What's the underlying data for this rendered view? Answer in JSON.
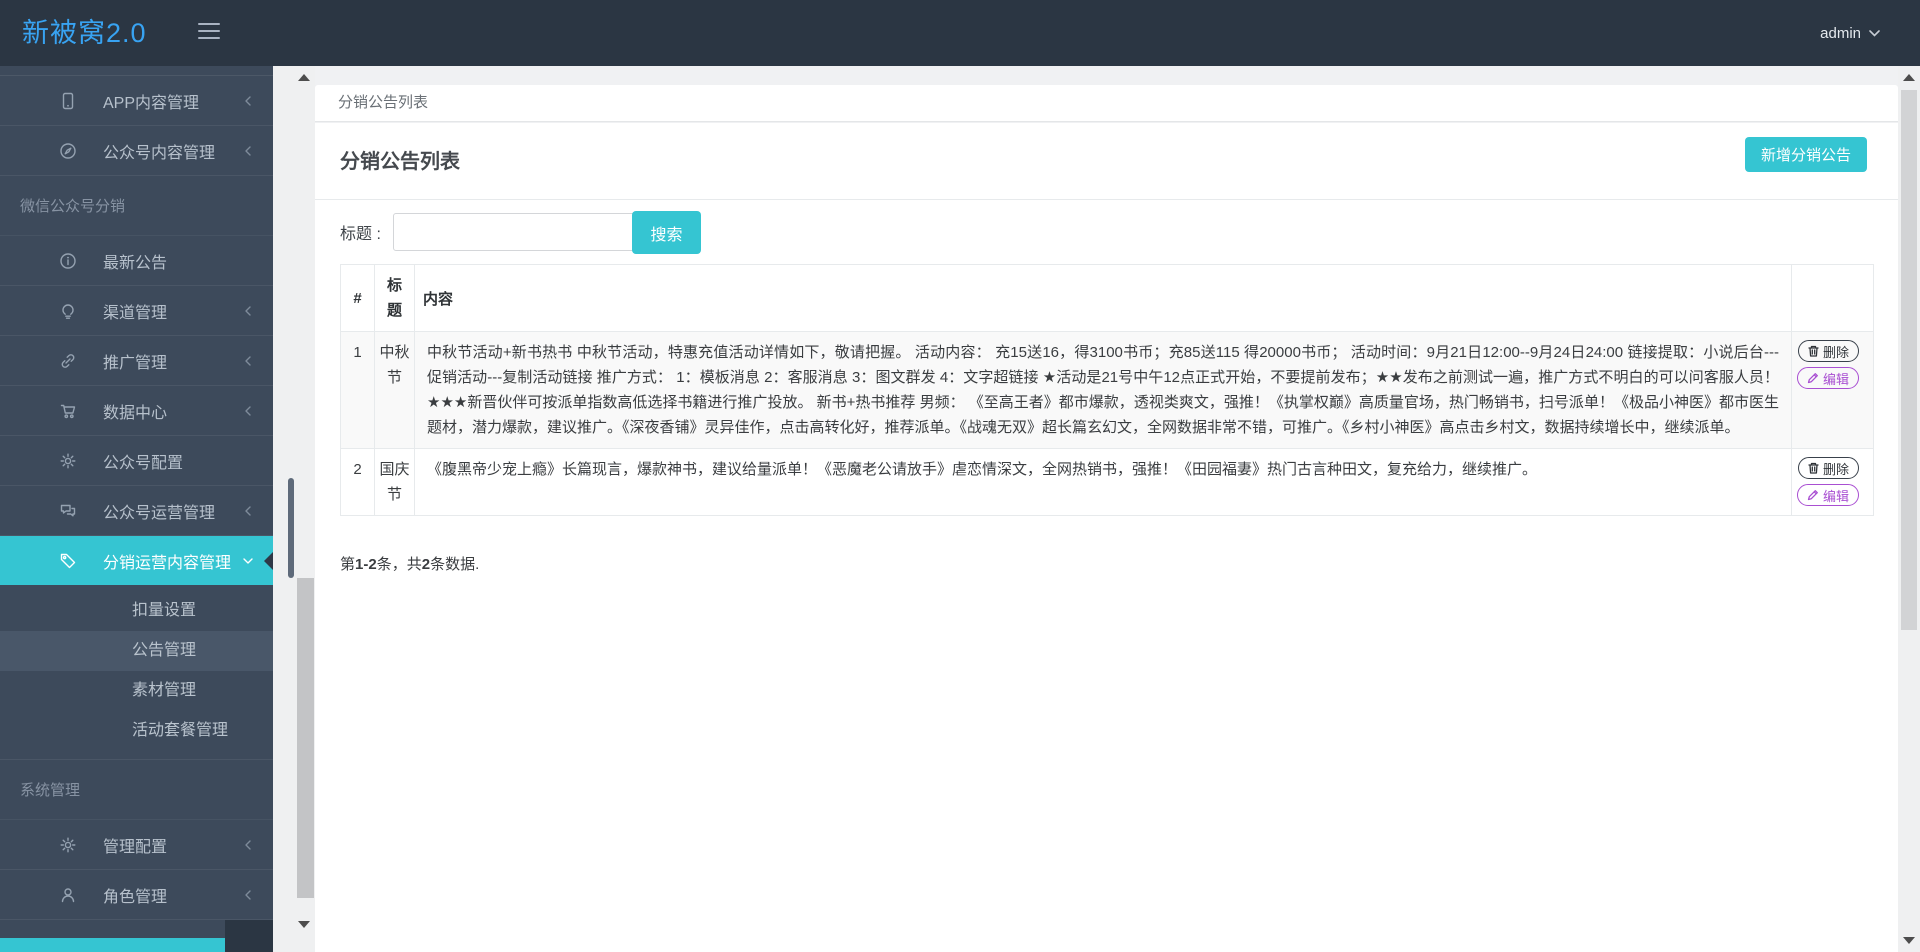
{
  "header": {
    "logo": "新被窝2.0",
    "user": "admin"
  },
  "sidebar": {
    "top_items": [
      {
        "label": "APP内容管理",
        "icon": "mobile-icon"
      },
      {
        "label": "公众号内容管理",
        "icon": "compass-icon"
      }
    ],
    "section_distribution": "微信公众号分销",
    "dist_items": [
      {
        "label": "最新公告",
        "icon": "info-icon"
      },
      {
        "label": "渠道管理",
        "icon": "lightbulb-icon"
      },
      {
        "label": "推广管理",
        "icon": "link-icon"
      },
      {
        "label": "数据中心",
        "icon": "cart-icon"
      },
      {
        "label": "公众号配置",
        "icon": "gear-icon"
      },
      {
        "label": "公众号运营管理",
        "icon": "comments-icon"
      }
    ],
    "active_item": {
      "label": "分销运营内容管理",
      "icon": "tags-icon"
    },
    "submenu": [
      {
        "label": "扣量设置"
      },
      {
        "label": "公告管理",
        "active": true
      },
      {
        "label": "素材管理"
      },
      {
        "label": "活动套餐管理"
      }
    ],
    "section_system": "系统管理",
    "system_items": [
      {
        "label": "管理配置",
        "icon": "gear-icon"
      },
      {
        "label": "角色管理",
        "icon": "user-icon"
      }
    ]
  },
  "breadcrumb": {
    "title": "分销公告列表"
  },
  "panel": {
    "title": "分销公告列表",
    "add_button": "新增分销公告",
    "search": {
      "label": "标题 :",
      "value": "",
      "button": "搜索"
    },
    "table": {
      "headers": {
        "index": "#",
        "title": "标题",
        "content": "内容"
      },
      "actions": {
        "delete": "删除",
        "edit": "编辑"
      },
      "rows": [
        {
          "index": "1",
          "title": "中秋节",
          "content": "中秋节活动+新书热书 中秋节活动，特惠充值活动详情如下，敬请把握。 活动内容： 充15送16，得3100书币；充85送115 得20000书币； 活动时间：9月21日12:00--9月24日24:00 链接提取：小说后台---促销活动---复制活动链接 推广方式： 1：模板消息 2：客服消息 3：图文群发 4：文字超链接 ★活动是21号中午12点正式开始，不要提前发布；★★发布之前测试一遍，推广方式不明白的可以问客服人员！★★★新晋伙伴可按派单指数高低选择书籍进行推广投放。 新书+热书推荐 男频： 《至高王者》都市爆款，透视类爽文，强推！《执掌权巅》高质量官场，热门畅销书，扫号派单！《极品小神医》都市医生题材，潜力爆款，建议推广。《深夜香铺》灵异佳作，点击高转化好，推荐派单。《战魂无双》超长篇玄幻文，全网数据非常不错，可推广。《乡村小神医》高点击乡村文，数据持续增长中，继续派单。"
        },
        {
          "index": "2",
          "title": "国庆节",
          "content": "《腹黑帝少宠上瘾》长篇现言，爆款神书，建议给量派单！《恶魔老公请放手》虐恋情深文，全网热销书，强推！《田园福妻》热门古言种田文，复充给力，继续推广。"
        }
      ]
    },
    "count": {
      "prefix": "第",
      "range": "1-2",
      "mid": "条，共",
      "total": "2",
      "suffix": "条数据."
    }
  },
  "colors": {
    "accent_teal": "#35c5d2",
    "header_bg": "#2b3643",
    "sidebar_bg": "#3d4a5b",
    "submenu_active_bg": "#495769",
    "logo_blue": "#38a3f2",
    "edit_purple": "#a94fd2",
    "delete_dark": "#39414b",
    "border": "#e7eaec",
    "page_bg": "#f0f1f3"
  }
}
